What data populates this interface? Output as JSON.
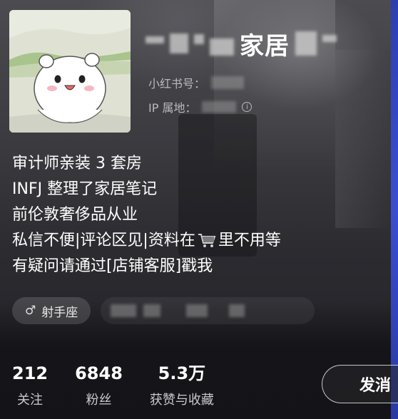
{
  "profile": {
    "nickname_visible": "家居",
    "xhs_id_label": "小红书号：",
    "ip_label": "IP 属地：",
    "info_icon": "info-icon"
  },
  "bio": {
    "line1": "审计师亲装 3 套房",
    "line2": "INFJ 整理了家居笔记",
    "line3": "前伦敦奢侈品从业",
    "line4_a": "私信不便|评论区见|资料在",
    "line4_b": "里不用等",
    "line5": "有疑问请通过[店铺客服]戳我",
    "cart_icon": "shopping-cart-icon"
  },
  "tags": {
    "zodiac": "射手座",
    "gender_icon": "male-icon"
  },
  "stats": [
    {
      "value": "212",
      "label": "关注"
    },
    {
      "value": "6848",
      "label": "粉丝"
    },
    {
      "value": "5.3万",
      "label": "获赞与收藏"
    }
  ],
  "actions": {
    "message_label": "发消"
  }
}
